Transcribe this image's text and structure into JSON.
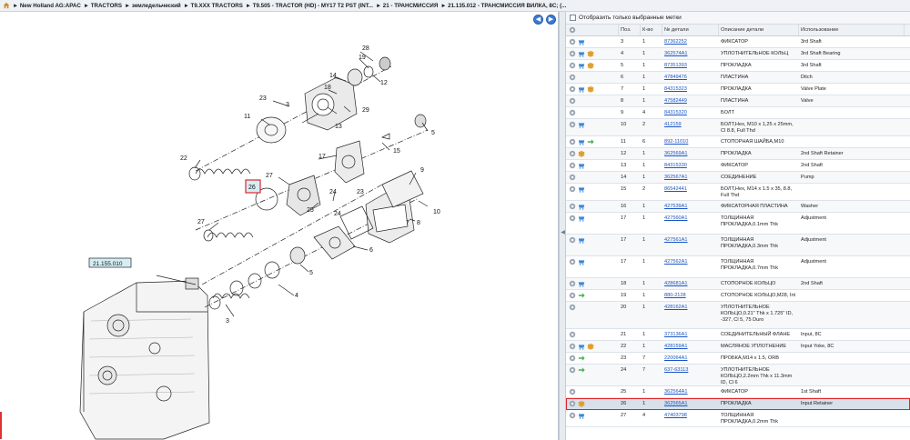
{
  "breadcrumb": [
    "New Holland AG:APAC",
    "TRACTORS",
    "земледельческий",
    "T9.XXX TRACTORS",
    "T9.505 - TRACTOR (HD) - MY17 T2 PST (INT...",
    "21 - ТРАНСМИССИЯ",
    "21.135.012 - ТРАНСМИССИЯ ВИЛКА, 8С; (..."
  ],
  "diagram": {
    "reference_label": "21.155.010",
    "selected_callout": "26",
    "callouts": [
      "28",
      "19",
      "14",
      "18",
      "23",
      "3",
      "13",
      "29",
      "11",
      "12",
      "5",
      "15",
      "17",
      "22",
      "27",
      "25",
      "24",
      "23",
      "9",
      "26",
      "24",
      "7",
      "10",
      "27",
      "8",
      "6",
      "5",
      "4",
      "3",
      "2",
      "1"
    ]
  },
  "filter": {
    "label": "Отобразить только выбранные метки",
    "checked": false
  },
  "table": {
    "columns": [
      "",
      "Поз.",
      "К-во",
      "№ детали",
      "Описание детали",
      "Использование"
    ],
    "rows": [
      {
        "icons": [
          "info",
          "cart"
        ],
        "pos": "3",
        "qty": "1",
        "part": "87362252",
        "desc": "ФИКСАТОР",
        "use": "3rd Shaft"
      },
      {
        "icons": [
          "info",
          "cart",
          "box"
        ],
        "pos": "4",
        "qty": "1",
        "part": "362574A1",
        "desc": "УПЛОТНИТЕЛЬНОЕ КОЛЬЦ",
        "use": "3rd Shaft Bearing"
      },
      {
        "icons": [
          "info",
          "cart",
          "box"
        ],
        "pos": "5",
        "qty": "1",
        "part": "87351393",
        "desc": "ПРОКЛАДКА",
        "use": "3rd Shaft"
      },
      {
        "icons": [
          "info"
        ],
        "pos": "6",
        "qty": "1",
        "part": "47849476",
        "desc": "ПЛАСТИНА",
        "use": "Ditch"
      },
      {
        "icons": [
          "info",
          "cart",
          "box"
        ],
        "pos": "7",
        "qty": "1",
        "part": "84315323",
        "desc": "ПРОКЛАДКА",
        "use": "Valve Plate"
      },
      {
        "icons": [
          "info"
        ],
        "pos": "8",
        "qty": "1",
        "part": "47582449",
        "desc": "ПЛАСТИНА",
        "use": "Valve"
      },
      {
        "icons": [
          "info"
        ],
        "pos": "9",
        "qty": "4",
        "part": "84315320",
        "desc": "БОЛТ",
        "use": ""
      },
      {
        "icons": [
          "info",
          "cart"
        ],
        "pos": "10",
        "qty": "2",
        "part": "412159",
        "desc": "БОЛТ,Hex, M10 x 1,25 x 25mm, Cl 8.8, Full Thd",
        "use": ""
      },
      {
        "icons": [
          "info",
          "cart",
          "alt"
        ],
        "pos": "11",
        "qty": "6",
        "part": "892-11010",
        "desc": "СТОПОРНАЯ ШАЙБА,M10",
        "use": ""
      },
      {
        "icons": [
          "info",
          "box"
        ],
        "pos": "12",
        "qty": "1",
        "part": "362569A1",
        "desc": "ПРОКЛАДКА",
        "use": "2nd Shaft Retainer"
      },
      {
        "icons": [
          "info",
          "cart"
        ],
        "pos": "13",
        "qty": "1",
        "part": "84315330",
        "desc": "ФИКСАТОР",
        "use": "2nd Shaft"
      },
      {
        "icons": [
          "info"
        ],
        "pos": "14",
        "qty": "1",
        "part": "362567A1",
        "desc": "СОЕДИНЕНИЕ",
        "use": "Pump"
      },
      {
        "icons": [
          "info",
          "cart"
        ],
        "pos": "15",
        "qty": "2",
        "part": "86542441",
        "desc": "БОЛТ,Hex, M14 x 1.5 x 35, 8.8, Full Thd",
        "use": ""
      },
      {
        "icons": [
          "info",
          "cart"
        ],
        "pos": "16",
        "qty": "1",
        "part": "427539A1",
        "desc": "ФИКСАТОРНАЯ ПЛАСТИНА",
        "use": "Washer"
      },
      {
        "icons": [
          "info",
          "cart"
        ],
        "pos": "17",
        "qty": "1",
        "part": "427560A1",
        "desc": "ТОЛЩИННАЯ ПРОКЛАДКА,0.1mm Thk",
        "use": "Adjustment"
      },
      {
        "icons": [
          "info",
          "cart"
        ],
        "pos": "17",
        "qty": "1",
        "part": "427561A1",
        "desc": "ТОЛЩИННАЯ ПРОКЛАДКА,0.3mm Thk",
        "use": "Adjustment"
      },
      {
        "icons": [
          "info",
          "cart"
        ],
        "pos": "17",
        "qty": "1",
        "part": "427562A1",
        "desc": "ТОЛЩИННАЯ ПРОКЛАДКА,0.7mm Thk",
        "use": "Adjustment"
      },
      {
        "icons": [
          "info",
          "cart"
        ],
        "pos": "18",
        "qty": "1",
        "part": "428681A1",
        "desc": "СТОПОРНОЕ КОЛЬЦО",
        "use": "2nd Shaft"
      },
      {
        "icons": [
          "info",
          "alt"
        ],
        "pos": "19",
        "qty": "1",
        "part": "880-2128",
        "desc": "СТОПОРНОЕ КОЛЬЦО,M28, Int",
        "use": ""
      },
      {
        "icons": [
          "info"
        ],
        "pos": "20",
        "qty": "1",
        "part": "428162A1",
        "desc": "УПЛОТНИТЕЛЬНОЕ КОЛЬЦО,0.21\" Thk x 1.725\" ID, -327, Cl 5, 75 Duro",
        "use": ""
      },
      {
        "icons": [
          "info"
        ],
        "pos": "21",
        "qty": "1",
        "part": "373136A1",
        "desc": "СОЕДИНИТЕЛЬНЫЙ ФЛАНЕ",
        "use": "Input, 8C"
      },
      {
        "icons": [
          "info",
          "cart",
          "box"
        ],
        "pos": "22",
        "qty": "1",
        "part": "428159A1",
        "desc": "МАСЛЯНОЕ УПЛОТНЕНИЕ",
        "use": "Input Yoke, 8C"
      },
      {
        "icons": [
          "info",
          "alt"
        ],
        "pos": "23",
        "qty": "7",
        "part": "220064A1",
        "desc": "ПРОБКА,M14 x 1.5, ORB",
        "use": ""
      },
      {
        "icons": [
          "info",
          "alt"
        ],
        "pos": "24",
        "qty": "7",
        "part": "637-63113",
        "desc": "УПЛОТНИТЕЛЬНОЕ КОЛЬЦО,2.2mm Thk x 11.3mm ID, Cl 6",
        "use": ""
      },
      {
        "icons": [
          "info"
        ],
        "pos": "25",
        "qty": "1",
        "part": "362564A1",
        "desc": "ФИКСАТОР",
        "use": "1st Shaft"
      },
      {
        "icons": [
          "info",
          "box"
        ],
        "pos": "26",
        "qty": "1",
        "part": "362565A1",
        "desc": "ПРОКЛАДКА",
        "use": "Input Retainer",
        "selected": true
      },
      {
        "icons": [
          "info",
          "cart"
        ],
        "pos": "27",
        "qty": "4",
        "part": "47403798",
        "desc": "ТОЛЩИННАЯ ПРОКЛАДКА,0.2mm Thk",
        "use": ""
      }
    ]
  },
  "icon_colors": {
    "info": "#9aa5b1",
    "cart": "#3a86d6",
    "box": "#e8a93a",
    "alt": "#4caf50"
  }
}
